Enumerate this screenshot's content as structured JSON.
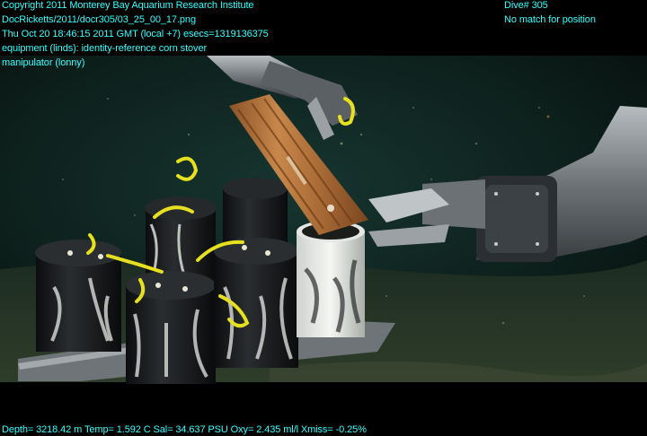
{
  "overlay": {
    "top_left": [
      "Copyright 2011 Monterey Bay Aquarium Research Institute",
      "DocRicketts/2011/docr305/03_25_00_17.png",
      "Thu Oct 20 18:46:15 2011 GMT (local +7)  esecs=1319136375",
      "equipment (linds): identity-reference corn stover",
      "manipulator (lonny)"
    ],
    "top_right": [
      "Dive# 305",
      "No match for position"
    ],
    "bottom": "Depth= 3218.42 m  Temp= 1.592 C  Sal= 34.637 PSU  Oxy= 2.435 ml/l  Xmiss= -0.25%",
    "text_color": "#33ffff"
  },
  "scene": {
    "subject": "ROV manipulator arm placing a wooden block into a white PVC core tube on a rack of instrument canisters",
    "colors": {
      "water": "#0f2622",
      "seafloor": "#2b3a28",
      "wood": "#b8773e",
      "canister": "#1a1c1e",
      "arm_metal": "#8c9296",
      "rope": "#e6e020"
    }
  }
}
